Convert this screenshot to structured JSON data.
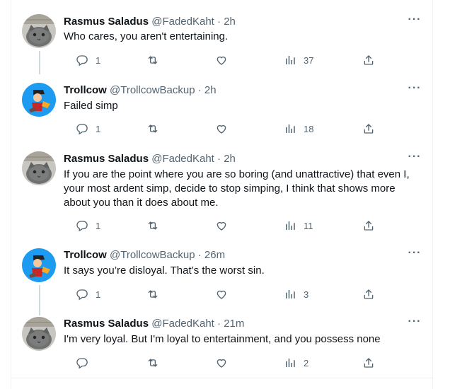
{
  "tweets": [
    {
      "author": "Rasmus Saladus",
      "handle": "@FadedKaht",
      "sep": "·",
      "time": "2h",
      "text": "Who cares, you aren't entertaining.",
      "replies": "1",
      "retweets": "",
      "likes": "",
      "views": "37",
      "avatar_icon": "cat-avatar"
    },
    {
      "author": "Trollcow",
      "handle": "@TrollcowBackup",
      "sep": "·",
      "time": "2h",
      "text": "Failed simp",
      "replies": "1",
      "retweets": "",
      "likes": "",
      "views": "18",
      "avatar_icon": "cartoon-avatar"
    },
    {
      "author": "Rasmus Saladus",
      "handle": "@FadedKaht",
      "sep": "·",
      "time": "2h",
      "text": "If you are the point where you are so boring (and unattractive) that even I, your most ardent simp, decide to stop simping, I think that shows more about you than it does about me.",
      "replies": "1",
      "retweets": "",
      "likes": "",
      "views": "11",
      "avatar_icon": "cat-avatar"
    },
    {
      "author": "Trollcow",
      "handle": "@TrollcowBackup",
      "sep": "·",
      "time": "26m",
      "text": "It says you’re disloyal. That’s the worst sin.",
      "replies": "1",
      "retweets": "",
      "likes": "",
      "views": "3",
      "avatar_icon": "cartoon-avatar"
    },
    {
      "author": "Rasmus Saladus",
      "handle": "@FadedKaht",
      "sep": "·",
      "time": "21m",
      "text": "I'm very loyal. But I'm loyal to entertainment, and you possess none",
      "replies": "",
      "retweets": "",
      "likes": "",
      "views": "2",
      "avatar_icon": "cat-avatar"
    }
  ],
  "more_label": "···",
  "colors": {
    "text": "#0f1419",
    "secondary": "#536471",
    "thread_line": "#cfd9de",
    "border": "#eff3f4"
  }
}
